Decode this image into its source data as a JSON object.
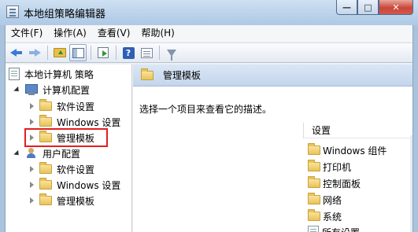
{
  "window": {
    "title": "本地组策略编辑器",
    "buttons": {
      "minimize": "—",
      "maximize": "□",
      "close": "✕"
    }
  },
  "menu": [
    "文件(F)",
    "操作(A)",
    "查看(V)",
    "帮助(H)"
  ],
  "toolbar": {
    "buttons": [
      "back-icon",
      "forward-icon",
      "up-folder-icon",
      "show-hide-tree-icon",
      "export-list-icon",
      "help-icon",
      "properties-icon",
      "filter-icon"
    ]
  },
  "tree": {
    "root": "本地计算机 策略",
    "computer_config": {
      "label": "计算机配置",
      "children": [
        "软件设置",
        "Windows 设置",
        "管理模板"
      ]
    },
    "user_config": {
      "label": "用户配置",
      "children": [
        "软件设置",
        "Windows 设置",
        "管理模板"
      ]
    },
    "selected": "管理模板"
  },
  "right": {
    "header": "管理模板",
    "description": "选择一个项目来查看它的描述。",
    "column_header": "设置",
    "items": [
      "Windows 组件",
      "打印机",
      "控制面板",
      "网络",
      "系统",
      "所有设置"
    ]
  },
  "colors": {
    "highlight_border": "#e02020",
    "folder": "#e8c35a",
    "titlebar": "#b9d1ea"
  }
}
